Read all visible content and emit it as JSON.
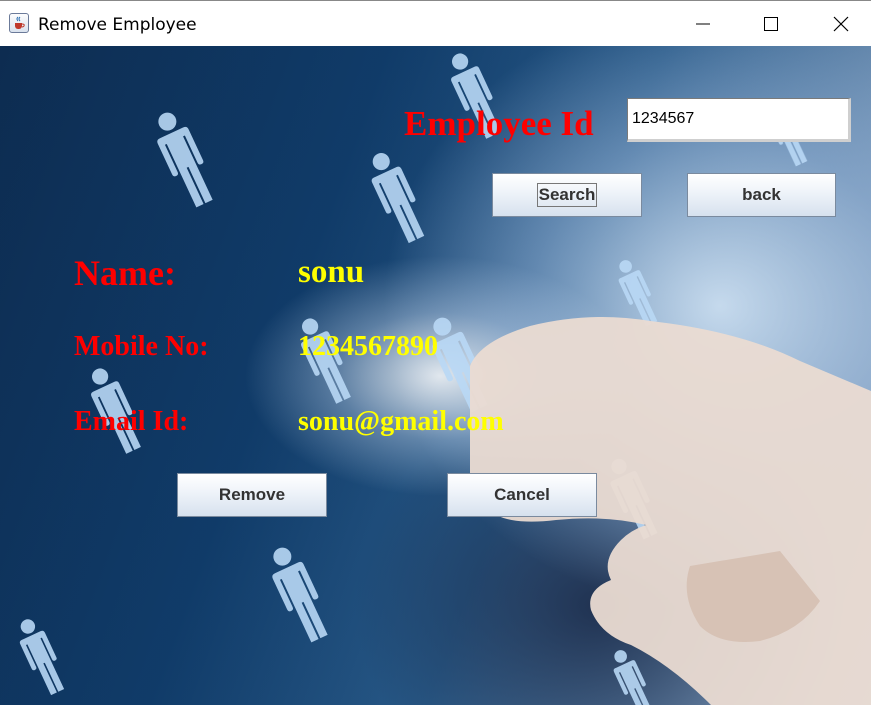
{
  "window": {
    "title": "Remove Employee",
    "icon": "java-cup-icon",
    "controls": [
      "minimize-icon",
      "maximize-icon",
      "close-icon"
    ]
  },
  "form": {
    "employee_id_label": "Employee Id",
    "employee_id_value": "1234567",
    "search_label": "Search",
    "back_label": "back",
    "name_label": "Name:",
    "name_value": "sonu",
    "mobile_label": "Mobile No:",
    "mobile_value": "1234567890",
    "email_label": "Email Id:",
    "email_value": "sonu@gmail.com",
    "remove_label": "Remove",
    "cancel_label": "Cancel"
  },
  "colors": {
    "label_color": "#ff0000",
    "value_color": "#ffff00"
  }
}
